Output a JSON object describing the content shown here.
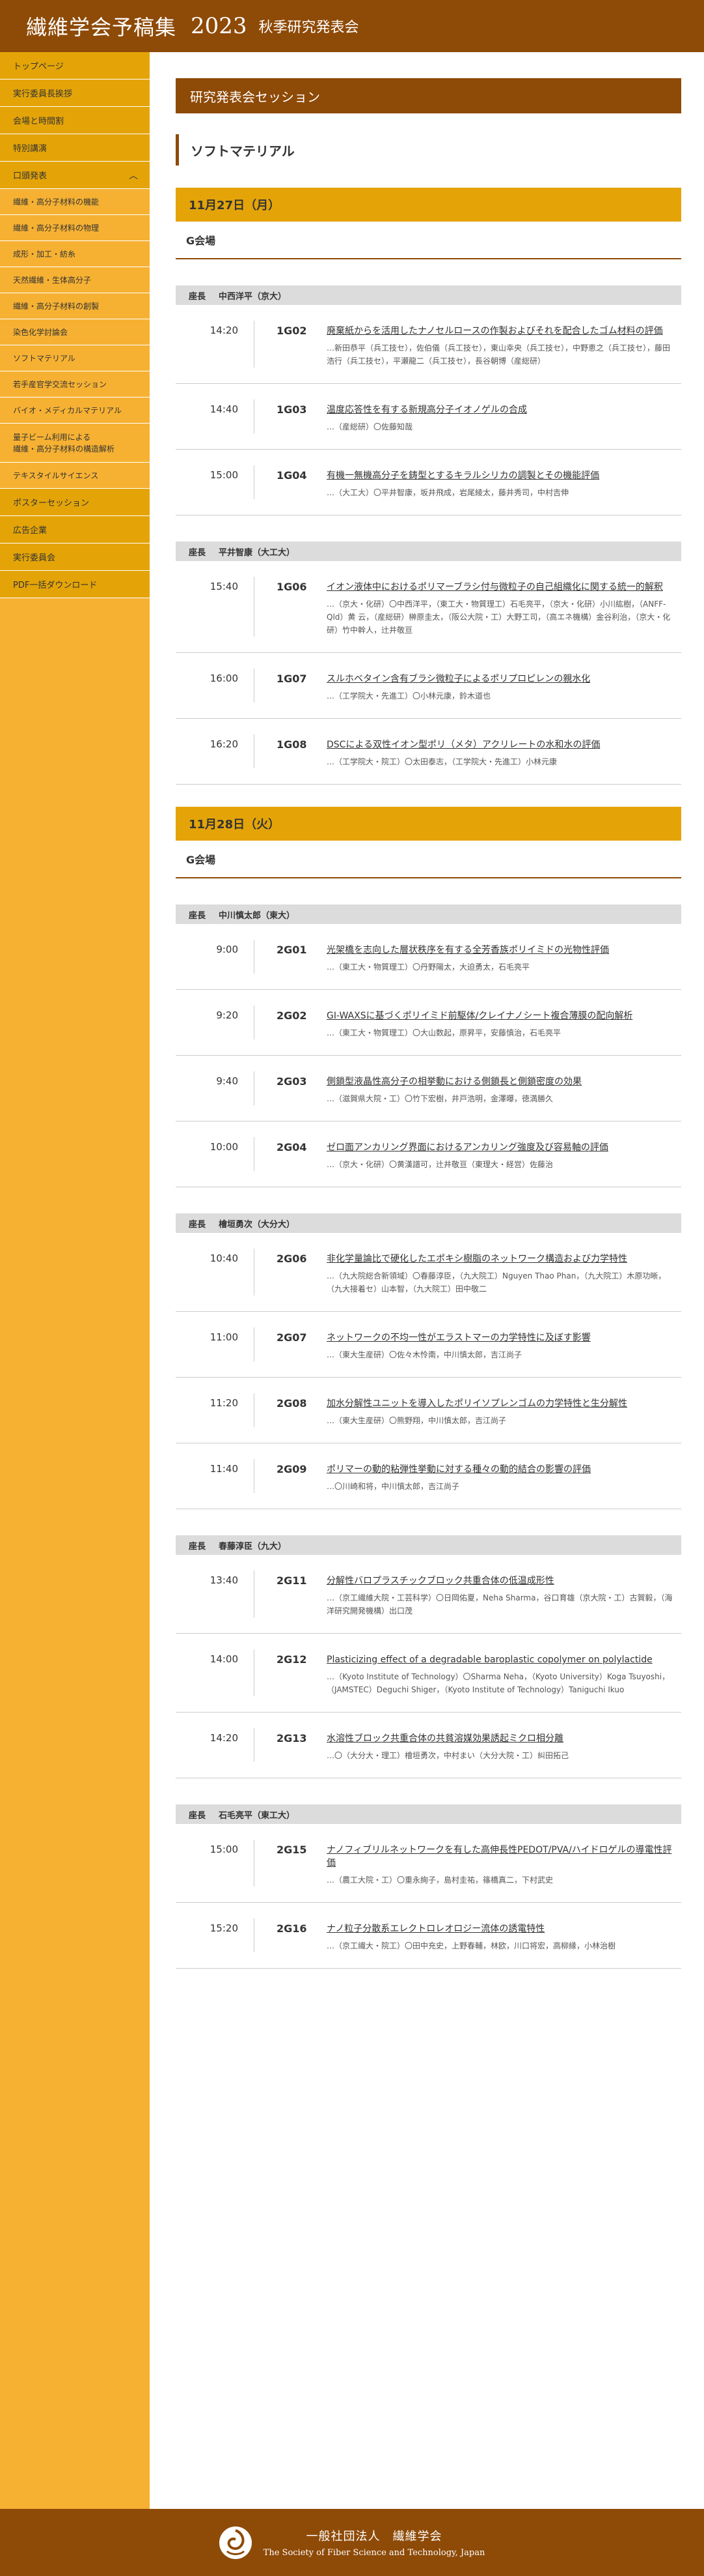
{
  "header": {
    "brand": "繊維学会予稿集",
    "year": "2023",
    "subtitle": "秋季研究発表会"
  },
  "sidebar": {
    "top_items": [
      "トップページ",
      "実行委員長挨拶",
      "会場と時間割",
      "特別講演",
      "口頭発表"
    ],
    "sub_items": [
      "繊維・高分子材料の機能",
      "繊維・高分子材料の物理",
      "成形・加工・紡糸",
      "天然繊維・生体高分子",
      "繊維・高分子材料の創製",
      "染色化学討論会",
      "ソフトマテリアル",
      "若手産官学交流セッション",
      "バイオ・メディカルマテリアル"
    ],
    "sub_item_tall": {
      "line1": "量子ビーム利用による",
      "line2": "繊維・高分子材料の構造解析"
    },
    "sub_items_after": [
      "テキスタイルサイエンス"
    ],
    "bottom_items": [
      "ポスターセッション",
      "広告企業",
      "実行委員会",
      "PDF一括ダウンロード"
    ]
  },
  "main": {
    "section_title": "研究発表会セッション",
    "subsection_title": "ソフトマテリアル",
    "chair_label": "座長",
    "days": [
      {
        "date": "11月27日（月）",
        "room": "G会場",
        "groups": [
          {
            "chair": "中西洋平（京大）",
            "talks": [
              {
                "time": "14:20",
                "code": "1G02",
                "title": "廃棄紙からを活用したナノセルロースの作製およびそれを配合したゴム材料の評価",
                "authors": "…新田恭平（兵工技セ），佐伯儀（兵工技セ），東山幸央（兵工技セ），中野恵之（兵工技セ），藤田浩行（兵工技セ），平瀬龍二（兵工技セ），長谷朝博（産総研）"
              },
              {
                "time": "14:40",
                "code": "1G03",
                "title": "温度応答性を有する新規高分子イオノゲルの合成",
                "authors": "…（産総研）〇佐藤知哉"
              },
              {
                "time": "15:00",
                "code": "1G04",
                "title": "有機一無機高分子を鋳型とするキラルシリカの調製とその機能評価",
                "authors": "…（大工大）〇平井智康，坂井飛成，岩尾綾太，藤井秀司，中村吉伸"
              }
            ]
          },
          {
            "chair": "平井智康（大工大）",
            "talks": [
              {
                "time": "15:40",
                "code": "1G06",
                "title": "イオン液体中におけるポリマーブラシ付与微粒子の自己組織化に関する統一的解釈",
                "authors": "…（京大・化研）〇中西洋平，（東工大・物質理工）石毛亮平，（京大・化研）小川紘樹，（ANFF-Qld）黄 云，（産総研）榊原圭太，（阪公大院・工）大野工司，（高エネ機構）金谷利治，（京大・化研）竹中幹人，辻井敬亘"
              },
              {
                "time": "16:00",
                "code": "1G07",
                "title": "スルホベタイン含有ブラシ微粒子によるポリプロピレンの親水化",
                "authors": "…（工学院大・先進工）〇小林元康，鈴木道也"
              },
              {
                "time": "16:20",
                "code": "1G08",
                "title": "DSCによる双性イオン型ポリ（メタ）アクリレートの水和水の評価",
                "authors": "…（工学院大・院工）〇太田泰志，（工学院大・先進工）小林元康"
              }
            ]
          }
        ]
      },
      {
        "date": "11月28日（火）",
        "room": "G会場",
        "groups": [
          {
            "chair": "中川慎太郎（東大）",
            "talks": [
              {
                "time": "9:00",
                "code": "2G01",
                "title": "光架橋を志向した層状秩序を有する全芳香族ポリイミドの光物性評価",
                "authors": "…（東工大・物質理工）〇丹野陽太，大迫勇太，石毛亮平"
              },
              {
                "time": "9:20",
                "code": "2G02",
                "title": "GI-WAXSに基づくポリイミド前駆体/クレイナノシート複合薄膜の配向解析",
                "authors": "…（東工大・物質理工）〇大山数起，原昇平，安藤慎治，石毛亮平"
              },
              {
                "time": "9:40",
                "code": "2G03",
                "title": "側鎖型液晶性高分子の相挙動における側鎖長と側鎖密度の効果",
                "authors": "…（滋賀県大院・工）〇竹下宏樹，井戸浩明，金澤曝，徳満勝久"
              },
              {
                "time": "10:00",
                "code": "2G04",
                "title": "ゼロ面アンカリング界面におけるアンカリング強度及び容易軸の評価",
                "authors": "…（京大・化研）〇黄漢譜可，辻井敬亘（東理大・経営）佐藤治"
              }
            ]
          },
          {
            "chair": "檜垣勇次（大分大）",
            "talks": [
              {
                "time": "10:40",
                "code": "2G06",
                "title": "非化学量論比で硬化したエポキシ樹脂のネットワーク構造および力学特性",
                "authors": "…（九大院総合新領域）〇春藤淳臣，（九大院工）Nguyen Thao Phan，（九大院工）木原功晰，（九大接着セ）山本智，（九大院工）田中敬二"
              },
              {
                "time": "11:00",
                "code": "2G07",
                "title": "ネットワークの不均一性がエラストマーの力学特性に及ぼす影響",
                "authors": "…（東大生産研）〇佐々木怜南，中川慎太郎，吉江尚子"
              },
              {
                "time": "11:20",
                "code": "2G08",
                "title": "加水分解性ユニットを導入したポリイソプレンゴムの力学特性と生分解性",
                "authors": "…（東大生産研）〇熊野翔，中川慎太郎，吉江尚子"
              },
              {
                "time": "11:40",
                "code": "2G09",
                "title": "ポリマーの動的粘弾性挙動に対する種々の動的結合の影響の評価",
                "authors": "…〇川崎和将，中川慎太郎，吉江尚子"
              }
            ]
          },
          {
            "chair": "春藤淳臣（九大）",
            "talks": [
              {
                "time": "13:40",
                "code": "2G11",
                "title": "分解性バロプラスチックブロック共重合体の低温成形性",
                "authors": "…（京工繊維大院・工芸科学）〇日岡佑夏，Neha Sharma，谷口育雄（京大院・工）古賀毅，（海洋研究開発機構）出口茂"
              },
              {
                "time": "14:00",
                "code": "2G12",
                "title": "Plasticizing effect of a degradable baroplastic copolymer on polylactide",
                "authors": "…（Kyoto Institute of Technology）〇Sharma Neha，（Kyoto University）Koga Tsuyoshi，（JAMSTEC）Deguchi Shiger，（Kyoto Institute of Technology）Taniguchi Ikuo"
              },
              {
                "time": "14:20",
                "code": "2G13",
                "title": "水溶性ブロック共重合体の共貧溶媒効果誘起ミクロ相分離",
                "authors": "…〇（大分大・理工）檜垣勇次，中村まい（大分大院・工）糾田拓己"
              }
            ]
          },
          {
            "chair": "石毛亮平（東工大）",
            "talks": [
              {
                "time": "15:00",
                "code": "2G15",
                "title": "ナノフィブリルネットワークを有した高伸長性PEDOT/PVA/ハイドロゲルの導電性評価",
                "authors": "…（農工大院・工）〇重永絢子，島村圭祐，篠橋真二，下村武史"
              },
              {
                "time": "15:20",
                "code": "2G16",
                "title": "ナノ粒子分散系エレクトロレオロジー流体の誘電特性",
                "authors": "…（京工繊大・院工）〇田中充史，上野春輔，林欧，川口将宏，高柳縁，小林治樹"
              }
            ]
          }
        ]
      }
    ]
  },
  "footer": {
    "org_jp": "一般社団法人　繊維学会",
    "org_en": "The Society of Fiber Science and Technology, Japan",
    "logo": "society-logo"
  },
  "colors": {
    "header_bg": "#8E4A07",
    "sidebar_bg": "#F6B133",
    "nav_active": "#E4A408",
    "day_bar": "#E4A408"
  }
}
